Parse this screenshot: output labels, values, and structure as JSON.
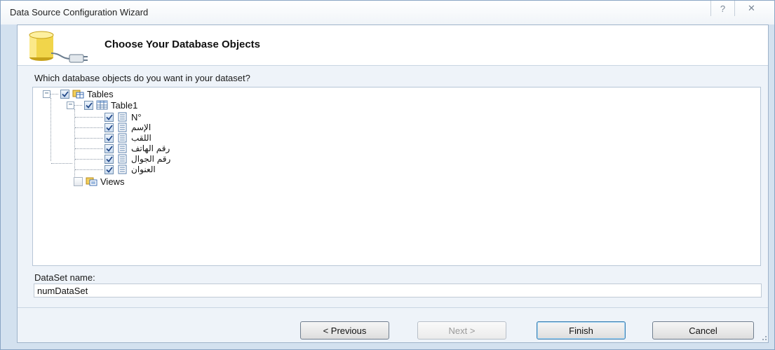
{
  "window": {
    "title": "Data Source Configuration Wizard",
    "help_glyph": "?",
    "close_glyph": "✕"
  },
  "header": {
    "heading": "Choose Your Database Objects",
    "icon": "database-plug-icon"
  },
  "content": {
    "question": "Which database objects do you want in your dataset?",
    "tree": {
      "tables": {
        "label": "Tables",
        "checked": true,
        "expanded": true,
        "table1": {
          "label": "Table1",
          "checked": true,
          "expanded": true,
          "columns": [
            {
              "label": "N°",
              "checked": true
            },
            {
              "label": "الإسم",
              "checked": true
            },
            {
              "label": "اللقب",
              "checked": true
            },
            {
              "label": "رقم الهاتف",
              "checked": true
            },
            {
              "label": "رقم الجوال",
              "checked": true
            },
            {
              "label": "العنوان",
              "checked": true
            }
          ]
        }
      },
      "views": {
        "label": "Views",
        "checked": false
      }
    },
    "dataset_label": "DataSet name:",
    "dataset_value": "numDataSet"
  },
  "buttons": {
    "previous": "< Previous",
    "next": "Next >",
    "finish": "Finish",
    "cancel": "Cancel"
  },
  "colors": {
    "window_background": "#d3e1ef",
    "panel_background": "#eef3f9",
    "default_button_border": "#3c7fb1"
  }
}
